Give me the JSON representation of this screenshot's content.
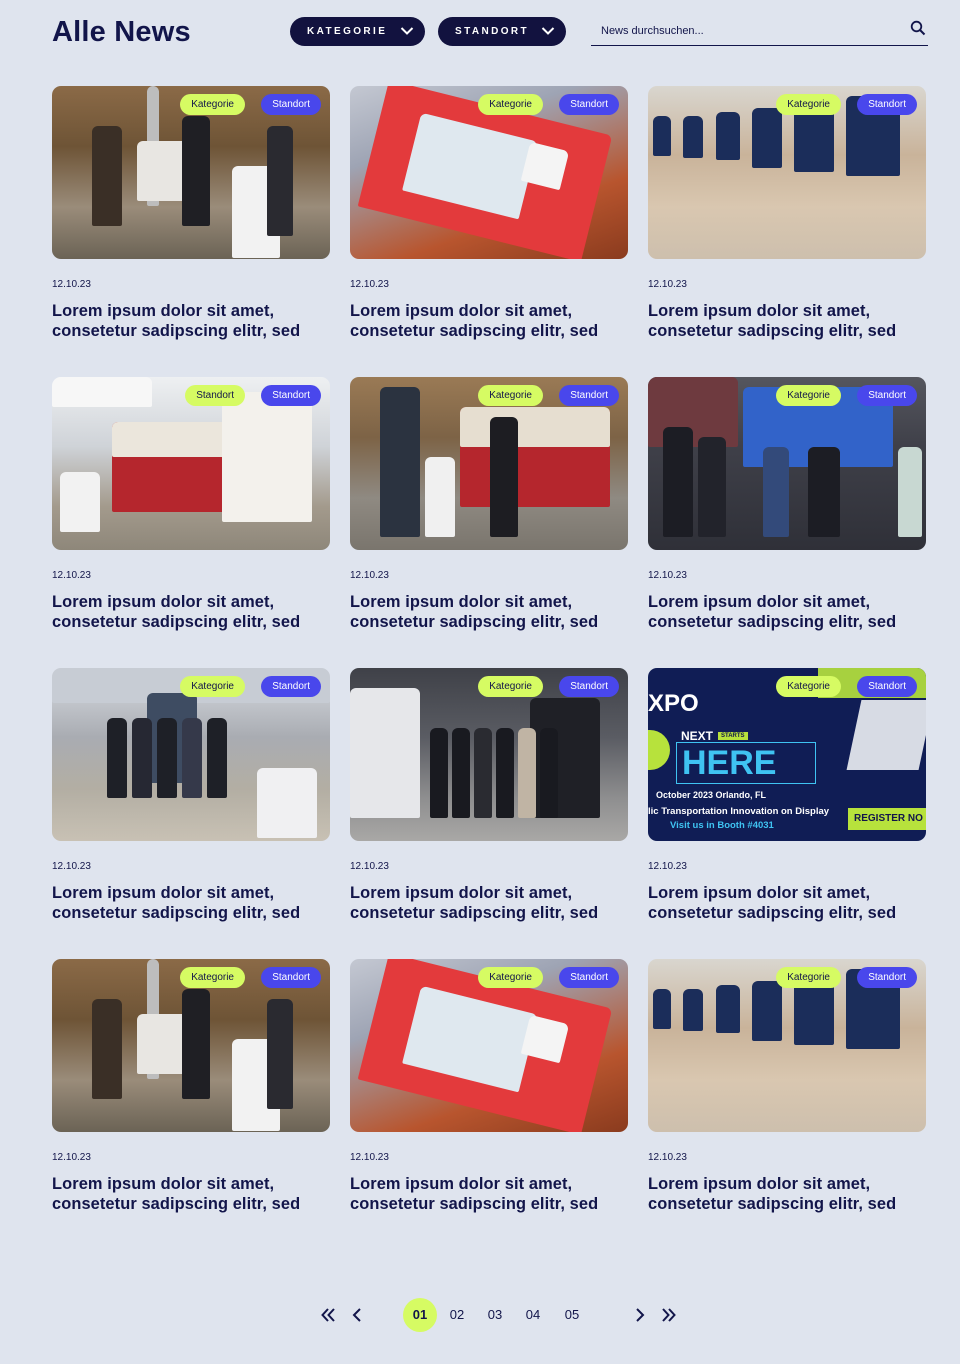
{
  "header": {
    "title": "Alle News",
    "filter_category": "KATEGORIE",
    "filter_location": "STANDORT",
    "search_placeholder": "News durchsuchen..."
  },
  "colors": {
    "background": "#dfe4ee",
    "navy": "#12123f",
    "lime": "#d6fb63",
    "indigo": "#4947ec"
  },
  "posts": [
    {
      "date": "12.10.23",
      "title": "Lorem ipsum dolor sit amet, consetetur sadipscing elitr, sed",
      "tag1": "Kategorie",
      "tag2": "Standort"
    },
    {
      "date": "12.10.23",
      "title": "Lorem ipsum dolor sit amet, consetetur sadipscing elitr, sed",
      "tag1": "Kategorie",
      "tag2": "Standort"
    },
    {
      "date": "12.10.23",
      "title": "Lorem ipsum dolor sit amet, consetetur sadipscing elitr, sed",
      "tag1": "Kategorie",
      "tag2": "Standort"
    },
    {
      "date": "12.10.23",
      "title": "Lorem ipsum dolor sit amet, consetetur sadipscing elitr, sed",
      "tag1": "Standort",
      "tag2": "Standort"
    },
    {
      "date": "12.10.23",
      "title": "Lorem ipsum dolor sit amet, consetetur sadipscing elitr, sed",
      "tag1": "Kategorie",
      "tag2": "Standort"
    },
    {
      "date": "12.10.23",
      "title": "Lorem ipsum dolor sit amet, consetetur sadipscing elitr, sed",
      "tag1": "Kategorie",
      "tag2": "Standort"
    },
    {
      "date": "12.10.23",
      "title": "Lorem ipsum dolor sit amet, consetetur sadipscing elitr, sed",
      "tag1": "Kategorie",
      "tag2": "Standort"
    },
    {
      "date": "12.10.23",
      "title": "Lorem ipsum dolor sit amet, consetetur sadipscing elitr, sed",
      "tag1": "Kategorie",
      "tag2": "Standort"
    },
    {
      "date": "12.10.23",
      "title": "Lorem ipsum dolor sit amet, consetetur sadipscing elitr, sed",
      "tag1": "Kategorie",
      "tag2": "Standort"
    },
    {
      "date": "12.10.23",
      "title": "Lorem ipsum dolor sit amet, consetetur sadipscing elitr, sed",
      "tag1": "Kategorie",
      "tag2": "Standort"
    },
    {
      "date": "12.10.23",
      "title": "Lorem ipsum dolor sit amet, consetetur sadipscing elitr, sed",
      "tag1": "Kategorie",
      "tag2": "Standort"
    },
    {
      "date": "12.10.23",
      "title": "Lorem ipsum dolor sit amet, consetetur sadipscing elitr, sed",
      "tag1": "Kategorie",
      "tag2": "Standort"
    }
  ],
  "expo_banner": {
    "line1": "XPO",
    "line2": "NEXT",
    "line2b": "STARTS",
    "line3": "HERE",
    "line4": "October 2023  Orlando, FL",
    "line5": "lic Transportation Innovation on Display",
    "line6": "Visit us in Booth #4031",
    "cta": "REGISTER NO"
  },
  "pagination": {
    "pages": [
      "01",
      "02",
      "03",
      "04",
      "05"
    ],
    "current": "01"
  }
}
